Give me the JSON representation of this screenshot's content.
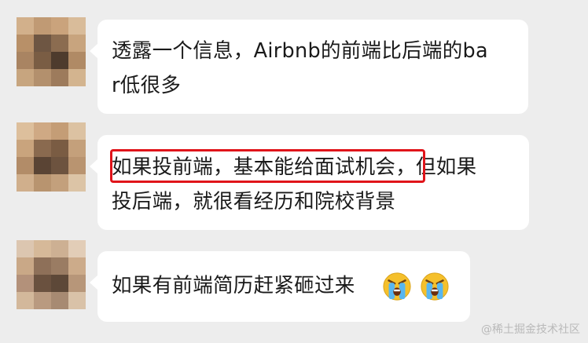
{
  "messages": [
    {
      "line1": "透露一个信息，Airbnb的前端比后端的ba",
      "line2": "r低很多"
    },
    {
      "line1_highlight": "如果投前端，基本能给面试机会",
      "line1_rest": "，但如果",
      "line2": "投后端，就很看经历和院校背景"
    },
    {
      "text": "如果有前端简历赶紧砸过来",
      "emoji_1": "crying-face-emoji",
      "emoji_2": "crying-face-emoji"
    }
  ],
  "watermark": "@稀土掘金技术社区",
  "colors": {
    "background": "#ededed",
    "bubble": "#ffffff",
    "highlight_border": "#e0141a",
    "text": "#1a1a1a"
  }
}
